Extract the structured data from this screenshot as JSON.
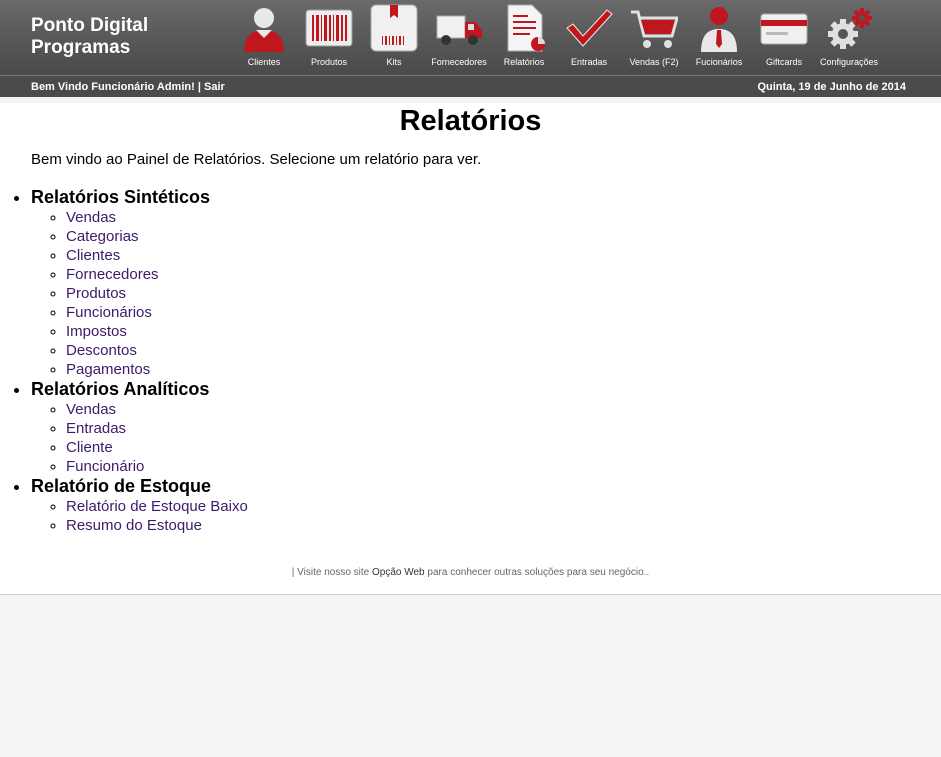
{
  "brand": {
    "line1": "Ponto Digital",
    "line2": "Programas"
  },
  "menu": [
    {
      "label": "Clientes",
      "icon": "user-icon"
    },
    {
      "label": "Produtos",
      "icon": "barcode-icon"
    },
    {
      "label": "Kits",
      "icon": "box-icon"
    },
    {
      "label": "Fornecedores",
      "icon": "truck-icon"
    },
    {
      "label": "Relatórios",
      "icon": "report-icon"
    },
    {
      "label": "Entradas",
      "icon": "checkmark-icon"
    },
    {
      "label": "Vendas (F2)",
      "icon": "cart-icon"
    },
    {
      "label": "Fucionários",
      "icon": "employee-icon"
    },
    {
      "label": "Giftcards",
      "icon": "giftcard-icon"
    },
    {
      "label": "Configurações",
      "icon": "gear-icon"
    }
  ],
  "subbar": {
    "welcome": "Bem Vindo Funcionário Admin!",
    "separator": " | ",
    "logout": "Sair",
    "date": "Quinta, 19 de Junho de 2014"
  },
  "page": {
    "title": "Relatórios",
    "intro": "Bem vindo ao Painel de Relatórios. Selecione um relatório para ver."
  },
  "sections": [
    {
      "title": "Relatórios Sintéticos",
      "items": [
        "Vendas",
        "Categorias",
        "Clientes",
        "Fornecedores",
        "Produtos",
        "Funcionários",
        "Impostos",
        "Descontos",
        "Pagamentos"
      ]
    },
    {
      "title": "Relatórios Analíticos",
      "items": [
        "Vendas",
        "Entradas",
        "Cliente",
        "Funcionário"
      ]
    },
    {
      "title": "Relatório de Estoque",
      "items": [
        "Relatório de Estoque Baixo",
        "Resumo do Estoque"
      ]
    }
  ],
  "footer": {
    "prefix": "| Visite nosso site ",
    "link": "Opção Web",
    "suffix": " para conhecer outras soluções para seu negócio.."
  },
  "colors": {
    "accent": "#c0161d",
    "header": "#5a5a5a",
    "link": "#3c1b6b"
  }
}
